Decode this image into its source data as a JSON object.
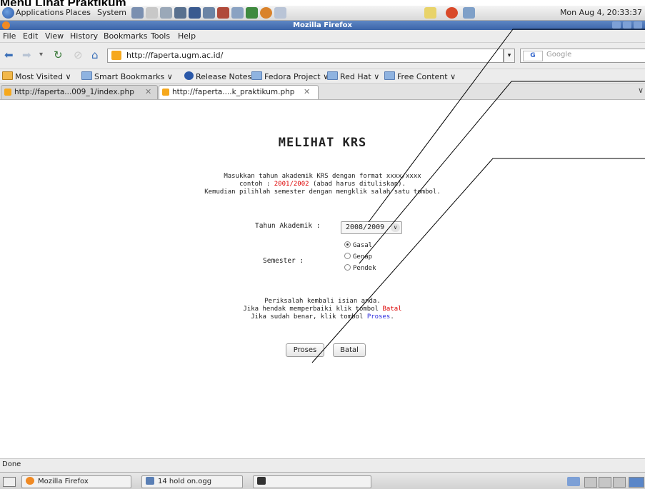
{
  "caption": "Menu Lihat Praktikum",
  "top_panel": {
    "menus": [
      "Applications",
      "Places",
      "System"
    ],
    "clock": "Mon Aug  4, 20:33:37"
  },
  "window": {
    "title": "Mozilla Firefox"
  },
  "menubar": [
    "File",
    "Edit",
    "View",
    "History",
    "Bookmarks",
    "Tools",
    "Help"
  ],
  "navbar": {
    "url": "http://faperta.ugm.ac.id/",
    "search_placeholder": "Google",
    "search_engine": "G"
  },
  "bookmarks": [
    "Most Visited",
    "Smart Bookmarks",
    "Release Notes",
    "Fedora Project",
    "Red Hat",
    "Free Content"
  ],
  "tabs": [
    {
      "label": "http://faperta...009_1/index.php"
    },
    {
      "label": "http://faperta....k_praktikum.php"
    }
  ],
  "content": {
    "title": "MELIHAT KRS",
    "instructions": {
      "line1": "Masukkan tahun akademik KRS dengan format xxxx/xxxx",
      "line2_prefix": "contoh : ",
      "line2_example": "2001/2002",
      "line2_suffix": " (abad harus dituliskan).",
      "line3": "Kemudian pilihlah semester dengan mengklik salah satu tombol."
    },
    "tahun_label": "Tahun Akademik :",
    "tahun_value": "2008/2009",
    "semester_label": "Semester :",
    "semester_options": [
      "Gasal",
      "Genap",
      "Pendek"
    ],
    "semester_selected": "Gasal",
    "review": {
      "line1": "Periksalah kembali isian anda.",
      "line2_prefix": "Jika hendak memperbaiki klik tombol ",
      "line2_link": "Batal",
      "line3_prefix": "Jika sudah benar, klik tombol ",
      "line3_link": "Proses",
      "line3_suffix": "."
    },
    "buttons": {
      "proses": "Proses",
      "batal": "Batal"
    }
  },
  "status": "Done",
  "taskbar": [
    "Mozilla Firefox",
    "14 hold on.ogg"
  ]
}
